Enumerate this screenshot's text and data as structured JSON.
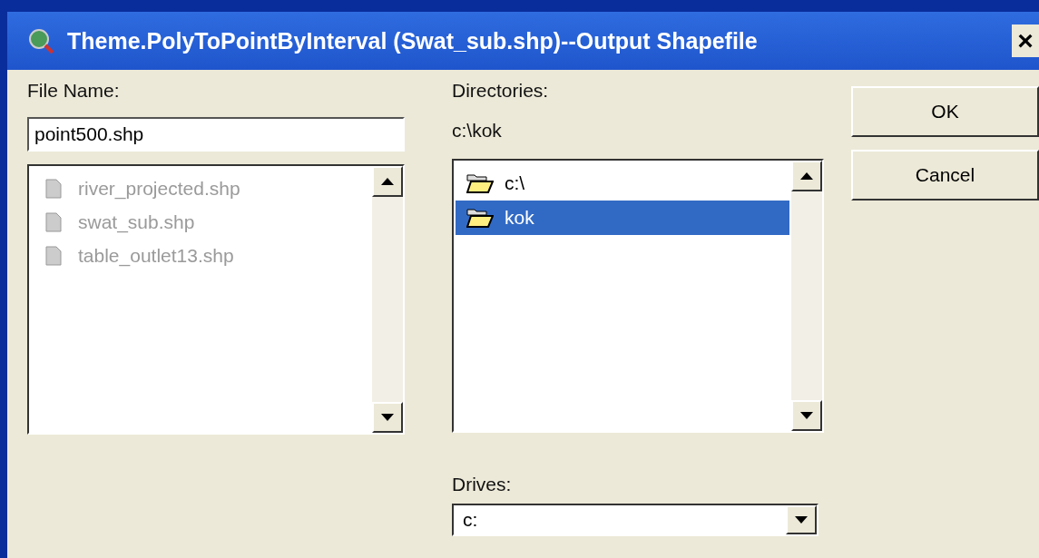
{
  "window": {
    "title": "Theme.PolyToPointByInterval (Swat_sub.shp)--Output Shapefile",
    "close": "×"
  },
  "file_name": {
    "label": "File Name:",
    "value": "point500.shp"
  },
  "files": [
    {
      "name": "river_projected.shp",
      "disabled": true
    },
    {
      "name": "swat_sub.shp",
      "disabled": true
    },
    {
      "name": "table_outlet13.shp",
      "disabled": true
    }
  ],
  "directories": {
    "label": "Directories:",
    "path": "c:\\kok",
    "items": [
      {
        "name": "c:\\",
        "selected": false
      },
      {
        "name": "kok",
        "selected": true
      }
    ]
  },
  "drives": {
    "label": "Drives:",
    "value": "c:"
  },
  "buttons": [
    "OK",
    "Cancel"
  ]
}
